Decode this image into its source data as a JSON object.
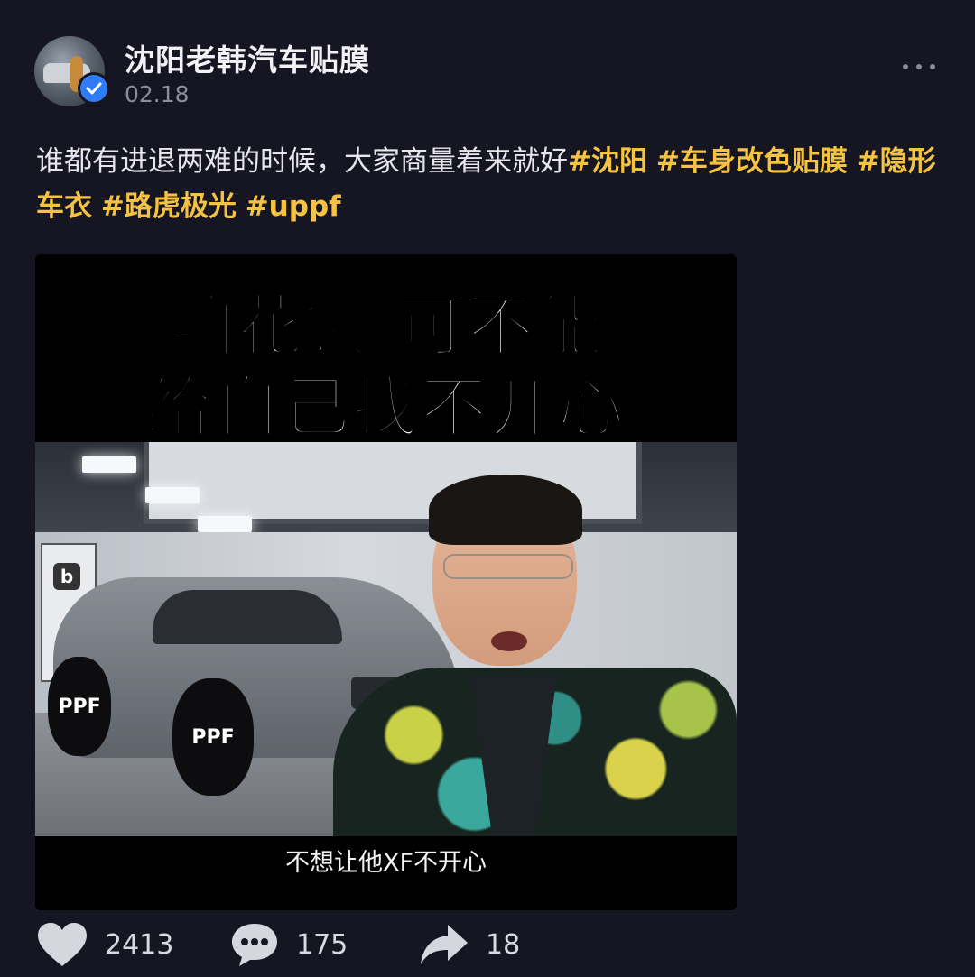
{
  "author": {
    "name": "沈阳老韩汽车贴膜",
    "date": "02.18",
    "verified": true
  },
  "post": {
    "text": "谁都有进退两难的时候，大家商量着来就好",
    "hashtags": [
      "#沈阳",
      "#车身改色贴膜",
      "#隐形车衣",
      "#路虎极光",
      "#uppf"
    ]
  },
  "video": {
    "title_line1": "咱花钱 可不能",
    "title_line2": "给自己找不开心",
    "subtitle": "不想让他XF不开心",
    "banner_logo": "b",
    "wheel_brand": "PPF"
  },
  "actions": {
    "likes": "2413",
    "comments": "175",
    "shares": "18"
  },
  "colors": {
    "background": "#161622",
    "hashtag": "#f5c242",
    "verified_badge": "#2f7cf6"
  }
}
